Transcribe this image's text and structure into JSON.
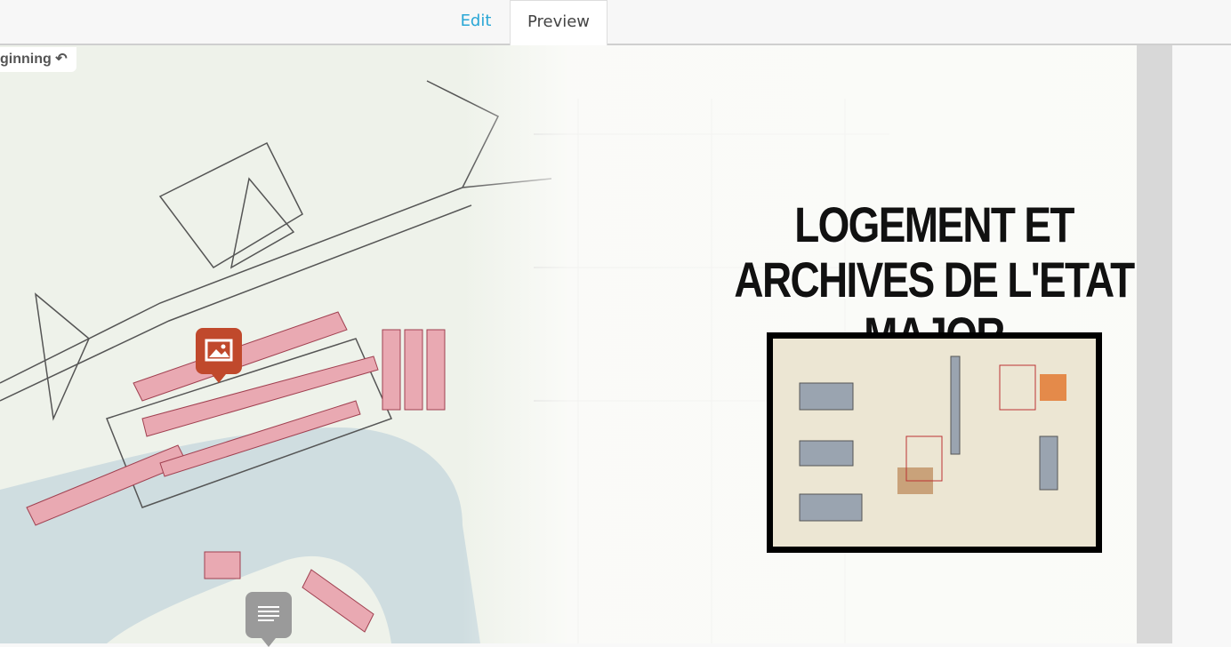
{
  "tabs": {
    "edit": "Edit",
    "preview": "Preview"
  },
  "back_link": "ginning",
  "slide": {
    "title": "LOGEMENT ET ARCHIVES DE L'ETAT MAJOR"
  },
  "markers": [
    {
      "icon": "image-icon",
      "color": "#c0492c"
    },
    {
      "icon": "text-icon",
      "color": "#9a9a9a"
    }
  ]
}
